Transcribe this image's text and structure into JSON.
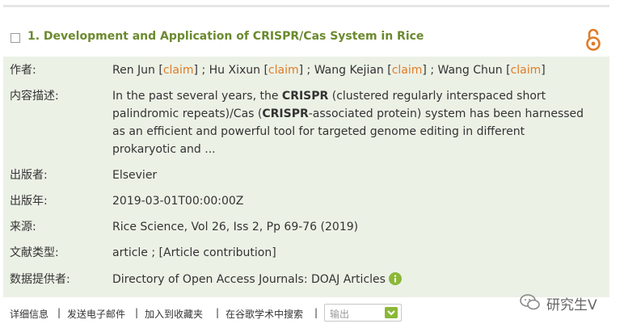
{
  "record": {
    "title": "1. Development and Application of CRISPR/Cas System in Rice",
    "authors": {
      "label": "作者:",
      "items": [
        {
          "name": "Ren Jun",
          "claim": "claim"
        },
        {
          "name": "Hu Xixun",
          "claim": "claim"
        },
        {
          "name": "Wang Kejian",
          "claim": "claim"
        },
        {
          "name": "Wang Chun",
          "claim": "claim"
        }
      ],
      "open_bracket": "[",
      "close_bracket": "]",
      "separator": " ; "
    },
    "description": {
      "label": "内容描述:",
      "p1": "In the past several years, the ",
      "b1": "CRISPR",
      "p2": " (clustered regularly interspaced short palindromic repeats)/Cas (",
      "b2": "CRISPR",
      "p3": "-associated protein) system has been harnessed as an efficient and powerful tool for targeted genome editing in different prokaryotic and ..."
    },
    "publisher": {
      "label": "出版者:",
      "value": "Elsevier"
    },
    "year": {
      "label": "出版年:",
      "value": "2019-03-01T00:00:00Z"
    },
    "source": {
      "label": "来源:",
      "value": "Rice Science, Vol 26, Iss 2, Pp 69-76 (2019)"
    },
    "doc_type": {
      "label": "文献类型:",
      "value": "article ; [Article contribution]"
    },
    "provider": {
      "label": "数据提供者:",
      "value": "Directory of Open Access Journals: DOAJ Articles"
    }
  },
  "actions": {
    "details": "详细信息",
    "email": "发送电子邮件",
    "favorite": "加入到收藏夹",
    "scholar": "在谷歌学术中搜索",
    "separator": "|",
    "export_placeholder": "输出"
  },
  "watermark": {
    "text": "研究生V"
  },
  "colors": {
    "title": "#6b8a2e",
    "claim": "#e07b26",
    "meta_bg": "#ecf1e6",
    "open_access_icon": "#e07b26",
    "info_icon": "#8bb837"
  },
  "icons": {
    "open_access": "open-access-lock-icon",
    "info": "info-icon",
    "dropdown": "chevron-down-icon",
    "watermark": "wechat-icon"
  }
}
